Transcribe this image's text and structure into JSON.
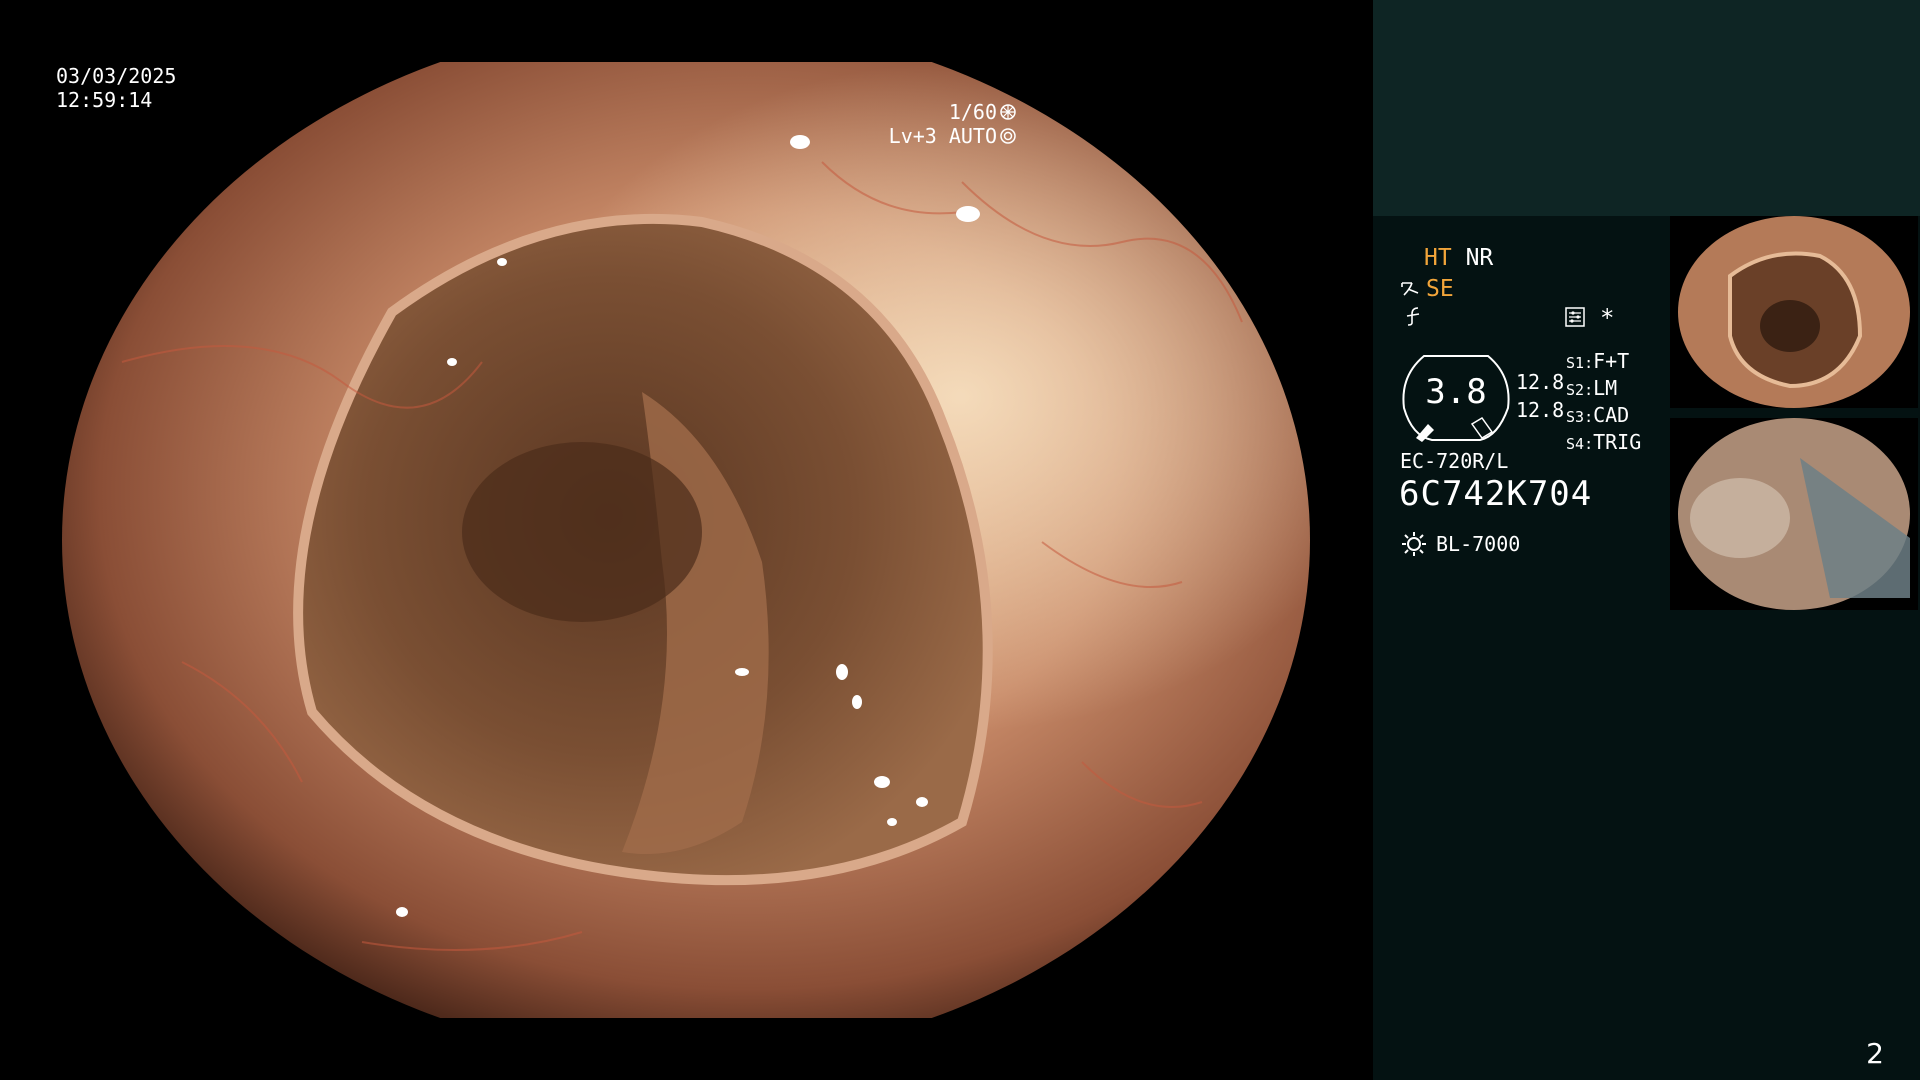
{
  "osd": {
    "date": "03/03/2025",
    "time": "12:59:14",
    "shutter": "1/60",
    "exposure_level": "Lv+3",
    "exposure_mode": "AUTO"
  },
  "modes": {
    "ht": "HT",
    "nr": "NR",
    "se": "SE"
  },
  "gauge": {
    "value": "3.8",
    "side_value_1": "12.8",
    "side_value_2": "12.8"
  },
  "switches": [
    {
      "key": "S1",
      "value": "F+T"
    },
    {
      "key": "S2",
      "value": "LM"
    },
    {
      "key": "S3",
      "value": "CAD"
    },
    {
      "key": "S4",
      "value": "TRIG"
    }
  ],
  "scope": {
    "model": "EC-720R/L",
    "serial": "6C742K704",
    "light_source": "BL-7000"
  },
  "page_number": "2",
  "colors": {
    "accent_amber": "#f2a53a",
    "panel_bg": "#061717",
    "panel_top_bg": "#0e2524"
  },
  "icons": [
    "shutter-icon",
    "auto-iris-icon",
    "structure-enhance-icon",
    "freeze-icon",
    "settings-icon",
    "asterisk-icon",
    "light-source-icon"
  ]
}
